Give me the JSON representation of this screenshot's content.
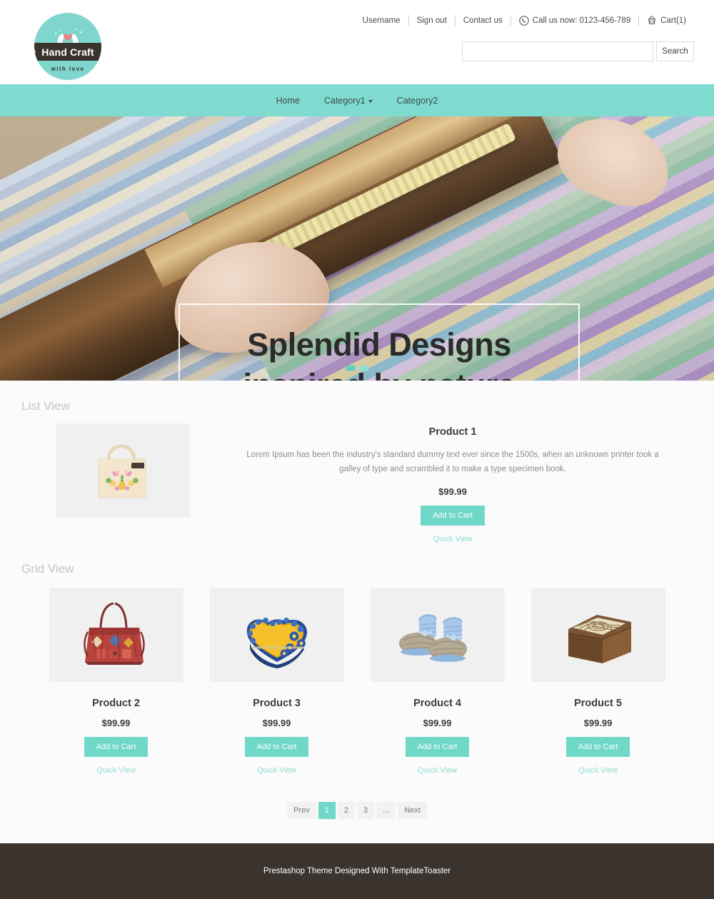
{
  "brand": {
    "name": "Hand Craft",
    "tagline": "with love",
    "logo_icon": "hands-heart-icon",
    "circle_color": "#7fd6ce",
    "ribbon_color": "#3b342e"
  },
  "topbar": {
    "links": [
      {
        "label": "Username",
        "icon": ""
      },
      {
        "label": "Sign out",
        "icon": ""
      },
      {
        "label": "Contact us",
        "icon": ""
      }
    ],
    "phone": {
      "icon": "phone-icon",
      "label": "Call us now: 0123-456-789"
    },
    "cart": {
      "icon": "cart-icon",
      "label": "Cart(1)"
    }
  },
  "search": {
    "value": "",
    "placeholder": "",
    "button_label": "Search"
  },
  "nav": {
    "items": [
      {
        "label": "Home",
        "has_dropdown": false
      },
      {
        "label": "Category1",
        "has_dropdown": true
      },
      {
        "label": "Category2",
        "has_dropdown": false
      }
    ],
    "bg_color": "#7fdbd0"
  },
  "hero": {
    "line1": "Splendid Designs",
    "line2": "inspired by nature",
    "slides": 2,
    "active_slide": 1
  },
  "sections": {
    "list_view_title": "List View",
    "grid_view_title": "Grid View"
  },
  "list_product": {
    "name": "Product 1",
    "description": "Lorem Ipsum has been the industry's standard dummy text ever since the 1500s, when an unknown printer took a galley of type and scrambled it to make a type specimen book.",
    "price": "$99.99",
    "add_to_cart_label": "Add to Cart",
    "quick_view_label": "Quick View",
    "image_alt": "beige-tote-bag-flamingo-print"
  },
  "grid_products": [
    {
      "name": "Product 2",
      "price": "$99.99",
      "add_to_cart_label": "Add to Cart",
      "quick_view_label": "Quick View",
      "image_alt": "red-embroidered-tote-bag"
    },
    {
      "name": "Product 3",
      "price": "$99.99",
      "add_to_cart_label": "Add to Cart",
      "quick_view_label": "Quick View",
      "image_alt": "yellow-blue-heart-box"
    },
    {
      "name": "Product 4",
      "price": "$99.99",
      "add_to_cart_label": "Add to Cart",
      "quick_view_label": "Quick View",
      "image_alt": "blue-crochet-baby-booties"
    },
    {
      "name": "Product 5",
      "price": "$99.99",
      "add_to_cart_label": "Add to Cart",
      "quick_view_label": "Quick View",
      "image_alt": "carved-wooden-box"
    }
  ],
  "pagination": {
    "prev_label": "Prev",
    "pages": [
      "1",
      "2",
      "3",
      "..."
    ],
    "active_page": "1",
    "next_label": "Next"
  },
  "footer": {
    "text": "Prestashop Theme Designed With TemplateToaster"
  },
  "colors": {
    "accent": "#6fd8c8",
    "nav": "#7fdbd0",
    "footer": "#3b342e",
    "page_bg": "#fbfbfb"
  }
}
